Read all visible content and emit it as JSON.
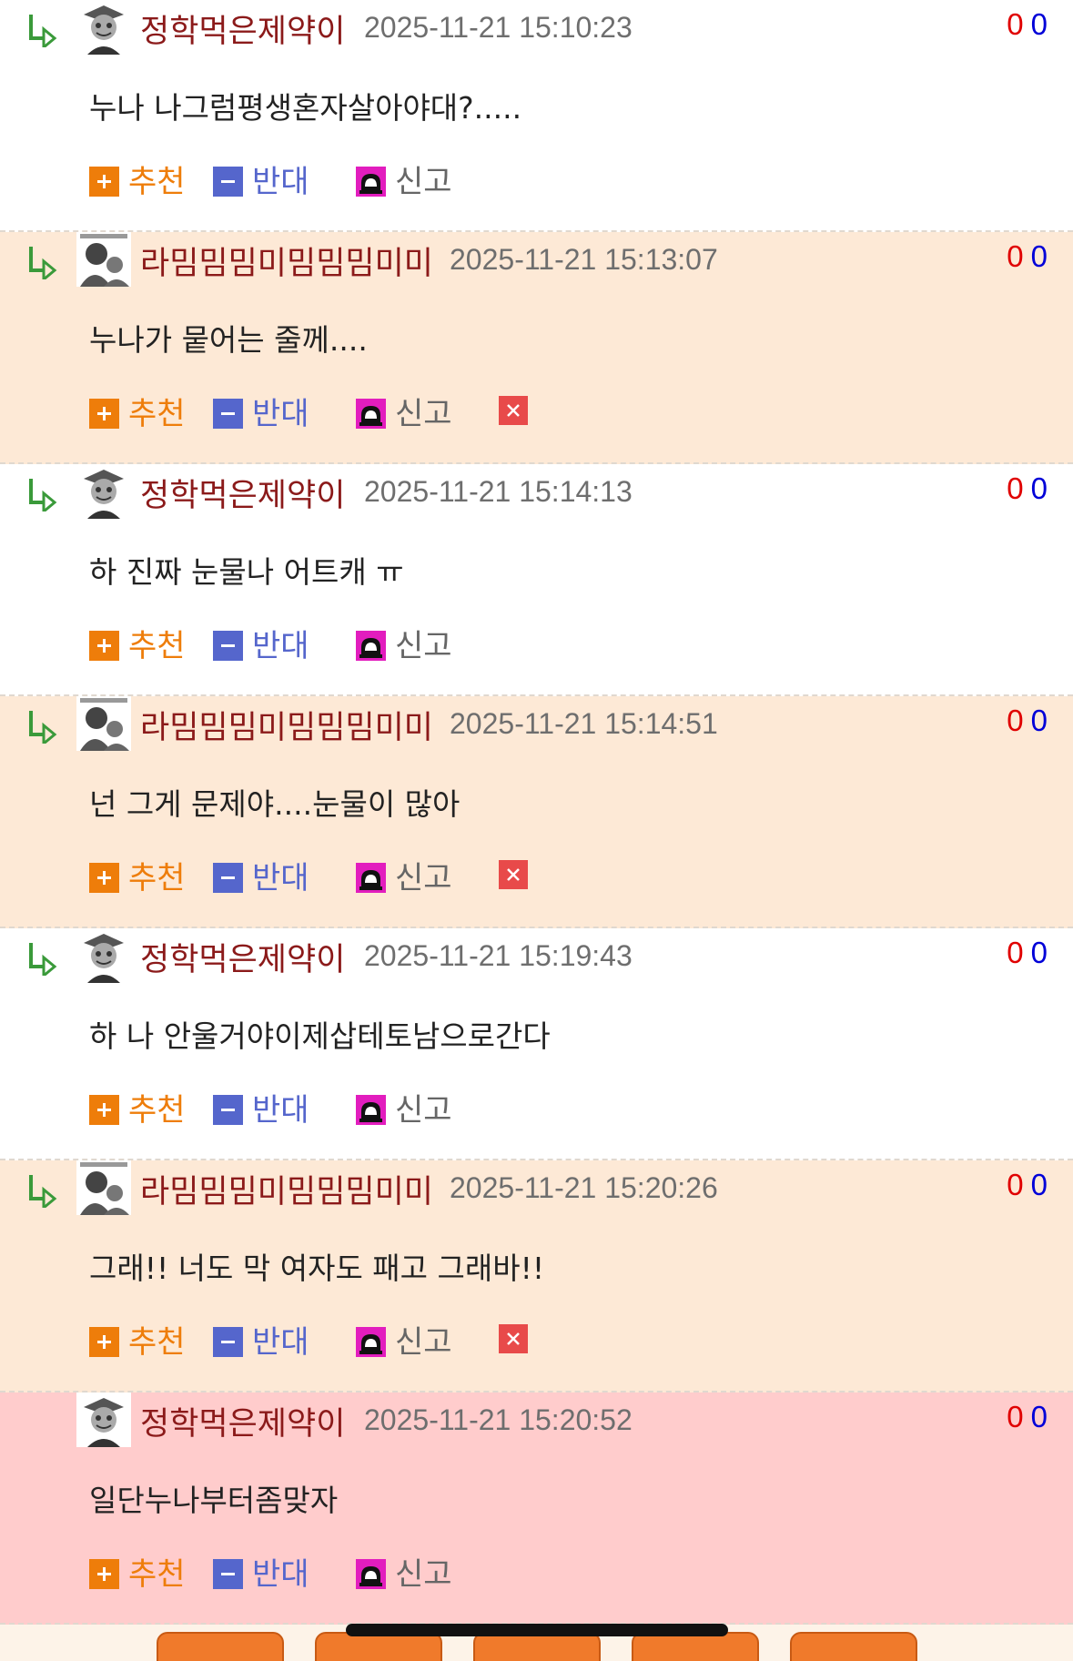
{
  "actions": {
    "recommend_label": "추천",
    "oppose_label": "반대",
    "report_label": "신고"
  },
  "comments": [
    {
      "author": "정학먹은제약이",
      "date": "2025-11-21 15:10:23",
      "text": "누나 나그럼평생혼자살아야대?.....",
      "up": "0",
      "down": "0"
    },
    {
      "author": "라밈밈밈미밈밈밈미미",
      "date": "2025-11-21 15:13:07",
      "text": "누나가 뭍어는 줄께....",
      "up": "0",
      "down": "0"
    },
    {
      "author": "정학먹은제약이",
      "date": "2025-11-21 15:14:13",
      "text": "하 진짜 눈물나 어트캐 ㅠ",
      "up": "0",
      "down": "0"
    },
    {
      "author": "라밈밈밈미밈밈밈미미",
      "date": "2025-11-21 15:14:51",
      "text": "넌 그게 문제야....눈물이 많아",
      "up": "0",
      "down": "0"
    },
    {
      "author": "정학먹은제약이",
      "date": "2025-11-21 15:19:43",
      "text": "하 나 안울거야이제삽테토남으로간다",
      "up": "0",
      "down": "0"
    },
    {
      "author": "라밈밈밈미밈밈밈미미",
      "date": "2025-11-21 15:20:26",
      "text": "그래!! 너도 막 여자도 패고 그래바!!",
      "up": "0",
      "down": "0"
    },
    {
      "author": "정학먹은제약이",
      "date": "2025-11-21 15:20:52",
      "text": "일단누나부터좀맞자",
      "up": "0",
      "down": "0"
    }
  ],
  "colors": {
    "peach_bg": "#fde9d6",
    "pink_bg": "#ffcccc",
    "author": "#8b1a1a",
    "recommend": "#ee7d0a",
    "oppose": "#5566cc"
  }
}
